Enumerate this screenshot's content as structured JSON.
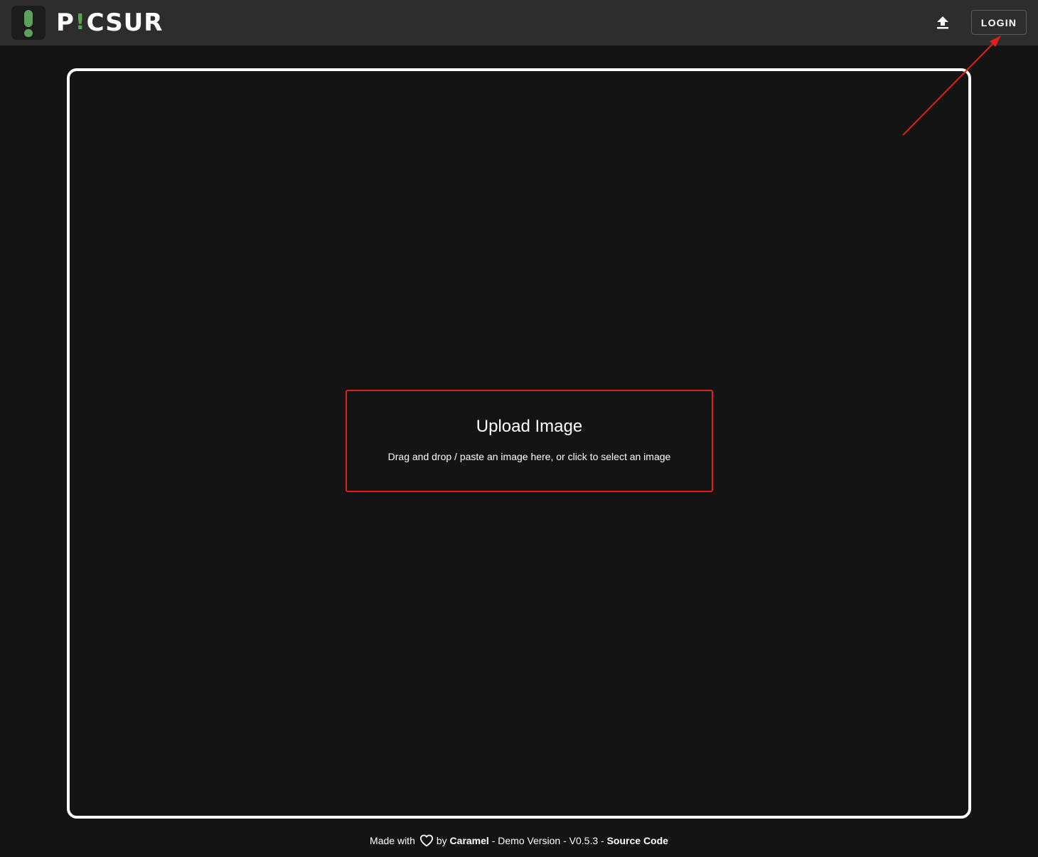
{
  "header": {
    "logo_text_before": "P",
    "logo_text_bang": "!",
    "logo_text_after": "CSUR",
    "login_label": "LOGIN",
    "upload_icon": "upload-icon",
    "brand_green": "#5aa25a"
  },
  "dropzone": {
    "title": "Upload Image",
    "subtitle": "Drag and drop / paste an image here, or click to select an image"
  },
  "footer": {
    "made_with": "Made with",
    "heart_icon": "heart-icon",
    "by": "by",
    "author": "Caramel",
    "sep1": "-",
    "demo": "Demo Version",
    "sep2": "-",
    "version": "V0.5.3",
    "sep3": "-",
    "source_code": "Source Code"
  },
  "annotation": {
    "arrow_color": "#e0201a",
    "highlight_color": "#e0201a"
  }
}
